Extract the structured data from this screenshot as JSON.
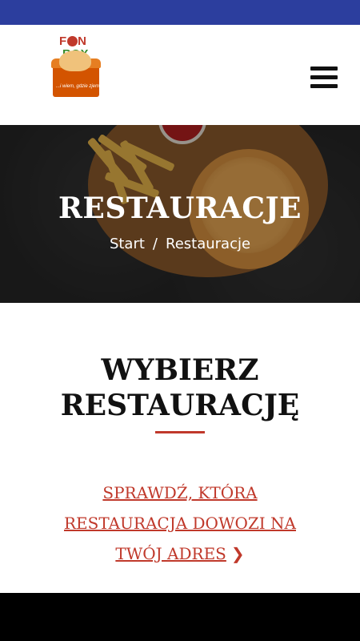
{
  "header": {
    "logo": {
      "brand_top": "F●N",
      "brand_bottom": "BOX",
      "slogan": "...i wiem, gdzie zjem"
    },
    "menu_icon": "hamburger-icon"
  },
  "hero": {
    "title": "RESTAURACJE",
    "breadcrumb": {
      "home": "Start",
      "separator": "/",
      "current": "Restauracje"
    }
  },
  "section": {
    "title_line1": "WYBIERZ",
    "title_line2": "RESTAURACJĘ",
    "accent_color": "#c0392b"
  },
  "cta": {
    "line1": "SPRAWDŹ, KTÓRA",
    "line2": "RESTAURACJA DOWOZI NA",
    "line3": "TWÓJ ADRES",
    "icon": "chevron-right-icon"
  },
  "colors": {
    "status_bar": "#2c3e9e",
    "accent": "#c0392b",
    "footer": "#000000"
  }
}
